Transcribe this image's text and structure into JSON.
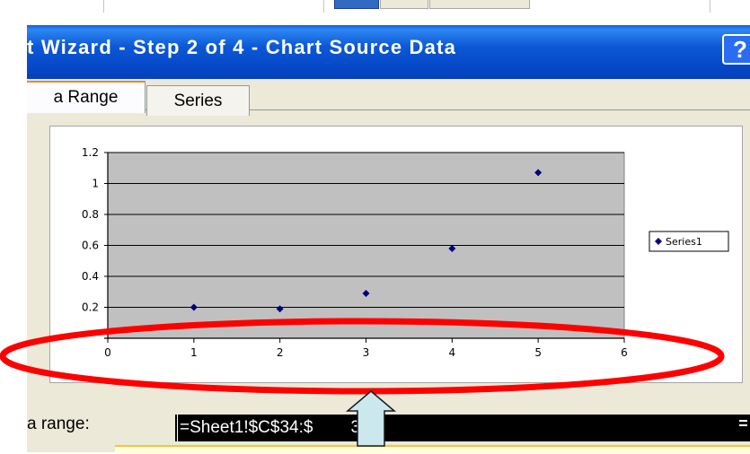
{
  "window": {
    "title": "t Wizard - Step 2 of 4 - Chart Source Data",
    "help_label": "?"
  },
  "tabs": [
    {
      "label": "a Range",
      "active": true
    },
    {
      "label": "Series",
      "active": false
    }
  ],
  "range": {
    "label": "a range:",
    "value": "=Sheet1!$C$34:$",
    "value_tail": "38"
  },
  "chart_data": {
    "type": "scatter",
    "title": "",
    "xlabel": "",
    "ylabel": "",
    "xlim": [
      0,
      6
    ],
    "ylim": [
      0,
      1.2
    ],
    "x_ticks": [
      "0",
      "1",
      "2",
      "3",
      "4",
      "5",
      "6"
    ],
    "y_ticks": [
      "0.2",
      "0.4",
      "0.6",
      "0.8",
      "1",
      "1.2"
    ],
    "series": [
      {
        "name": "Series1",
        "x": [
          1,
          2,
          3,
          4,
          5
        ],
        "y": [
          0.2,
          0.19,
          0.29,
          0.58,
          1.07
        ]
      }
    ],
    "grid": true,
    "legend_position": "right",
    "plot_background": "#c0c0c0",
    "marker_color": "#000080"
  },
  "colors": {
    "title_bar": "#0545c4",
    "dialog_bg": "#ece9d8",
    "highlight_ellipse": "#ff0000",
    "arrow_fill": "#cce8ef"
  },
  "icons": {
    "help": "help-icon",
    "collapse": "collapse-dialog-icon"
  }
}
